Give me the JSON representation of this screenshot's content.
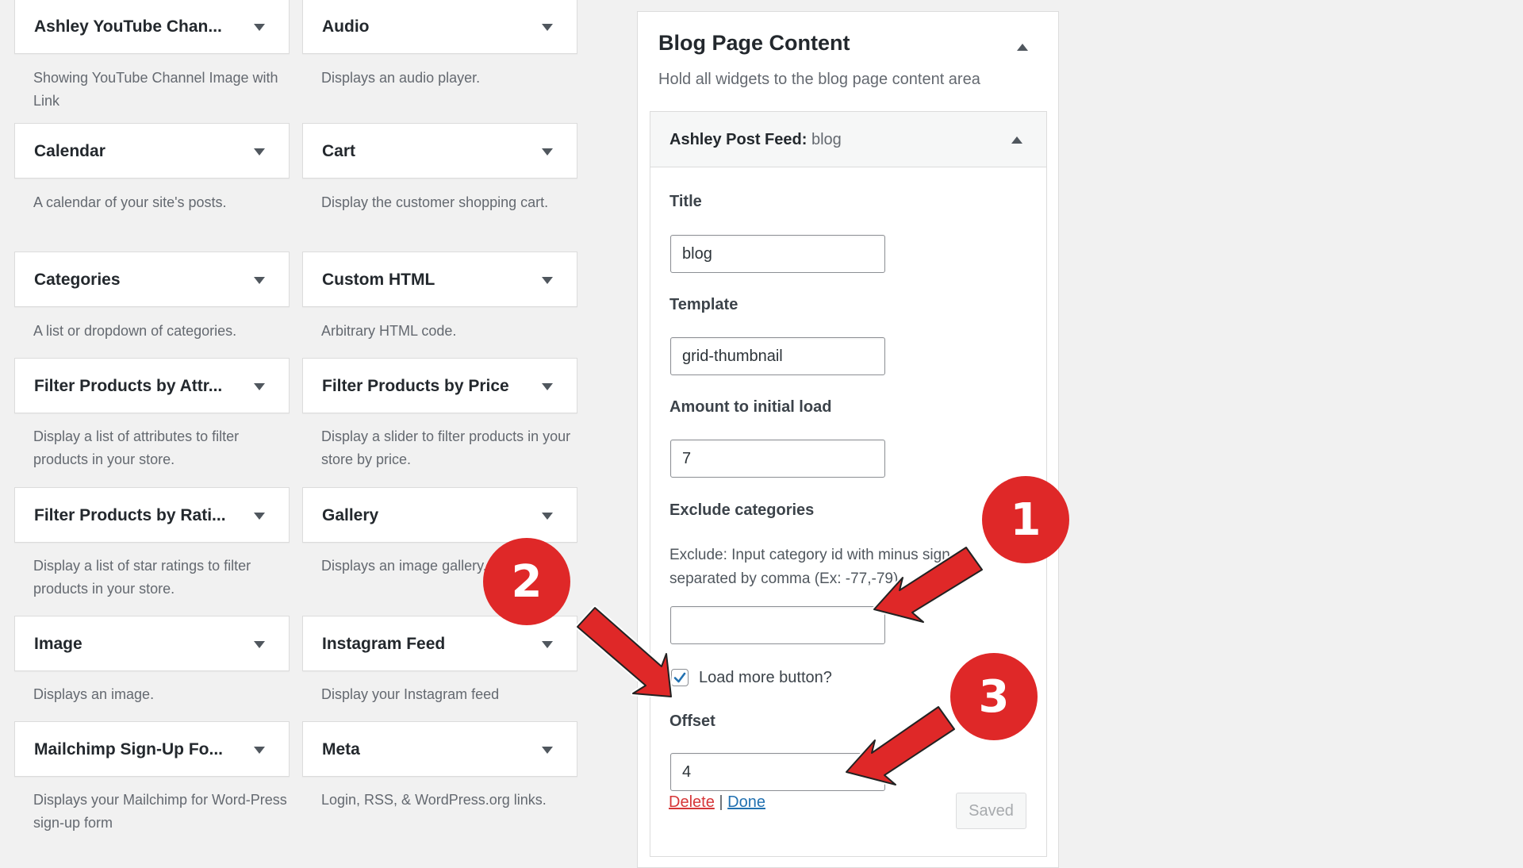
{
  "available_widgets": [
    {
      "title": "Ashley YouTube Chan...",
      "description": "Showing YouTube Channel Image with Link"
    },
    {
      "title": "Audio",
      "description": "Displays an audio player."
    },
    {
      "title": "Calendar",
      "description": "A calendar of your site's posts."
    },
    {
      "title": "Cart",
      "description": "Display the customer shopping cart."
    },
    {
      "title": "Categories",
      "description": "A list or dropdown of categories."
    },
    {
      "title": "Custom HTML",
      "description": "Arbitrary HTML code."
    },
    {
      "title": "Filter Products by Attr...",
      "description": "Display a list of attributes to filter products in your store."
    },
    {
      "title": "Filter Products by Price",
      "description": "Display a slider to filter products in your store by price."
    },
    {
      "title": "Filter Products by Rati...",
      "description": "Display a list of star ratings to filter products in your store."
    },
    {
      "title": "Gallery",
      "description": "Displays an image gallery."
    },
    {
      "title": "Image",
      "description": "Displays an image."
    },
    {
      "title": "Instagram Feed",
      "description": "Display your Instagram feed"
    },
    {
      "title": "Mailchimp Sign-Up Fo...",
      "description": "Displays your Mailchimp for Word-Press sign-up form"
    },
    {
      "title": "Meta",
      "description": "Login, RSS, & WordPress.org links."
    }
  ],
  "sidebar": {
    "title": "Blog Page Content",
    "description": "Hold all widgets to the blog page content area",
    "widget": {
      "name": "Ashley Post Feed:",
      "instance": "blog",
      "fields": {
        "title_label": "Title",
        "title_value": "blog",
        "template_label": "Template",
        "template_value": "grid-thumbnail",
        "amount_label": "Amount to initial load",
        "amount_value": "7",
        "exclude_label": "Exclude categories",
        "exclude_help_line1": "Exclude: Input category id with minus sign",
        "exclude_help_line2": "separated by comma (Ex: -77,-79)",
        "exclude_value": "",
        "load_more_label": "Load more button?",
        "load_more_checked": true,
        "offset_label": "Offset",
        "offset_value": "4"
      },
      "actions": {
        "delete": "Delete",
        "separator": "|",
        "done": "Done",
        "saved": "Saved"
      }
    }
  },
  "annotations": [
    {
      "number": "1"
    },
    {
      "number": "2"
    },
    {
      "number": "3"
    }
  ],
  "colors": {
    "accent": "#2271b1",
    "delete": "#d63638",
    "annotation": "#df2828"
  }
}
